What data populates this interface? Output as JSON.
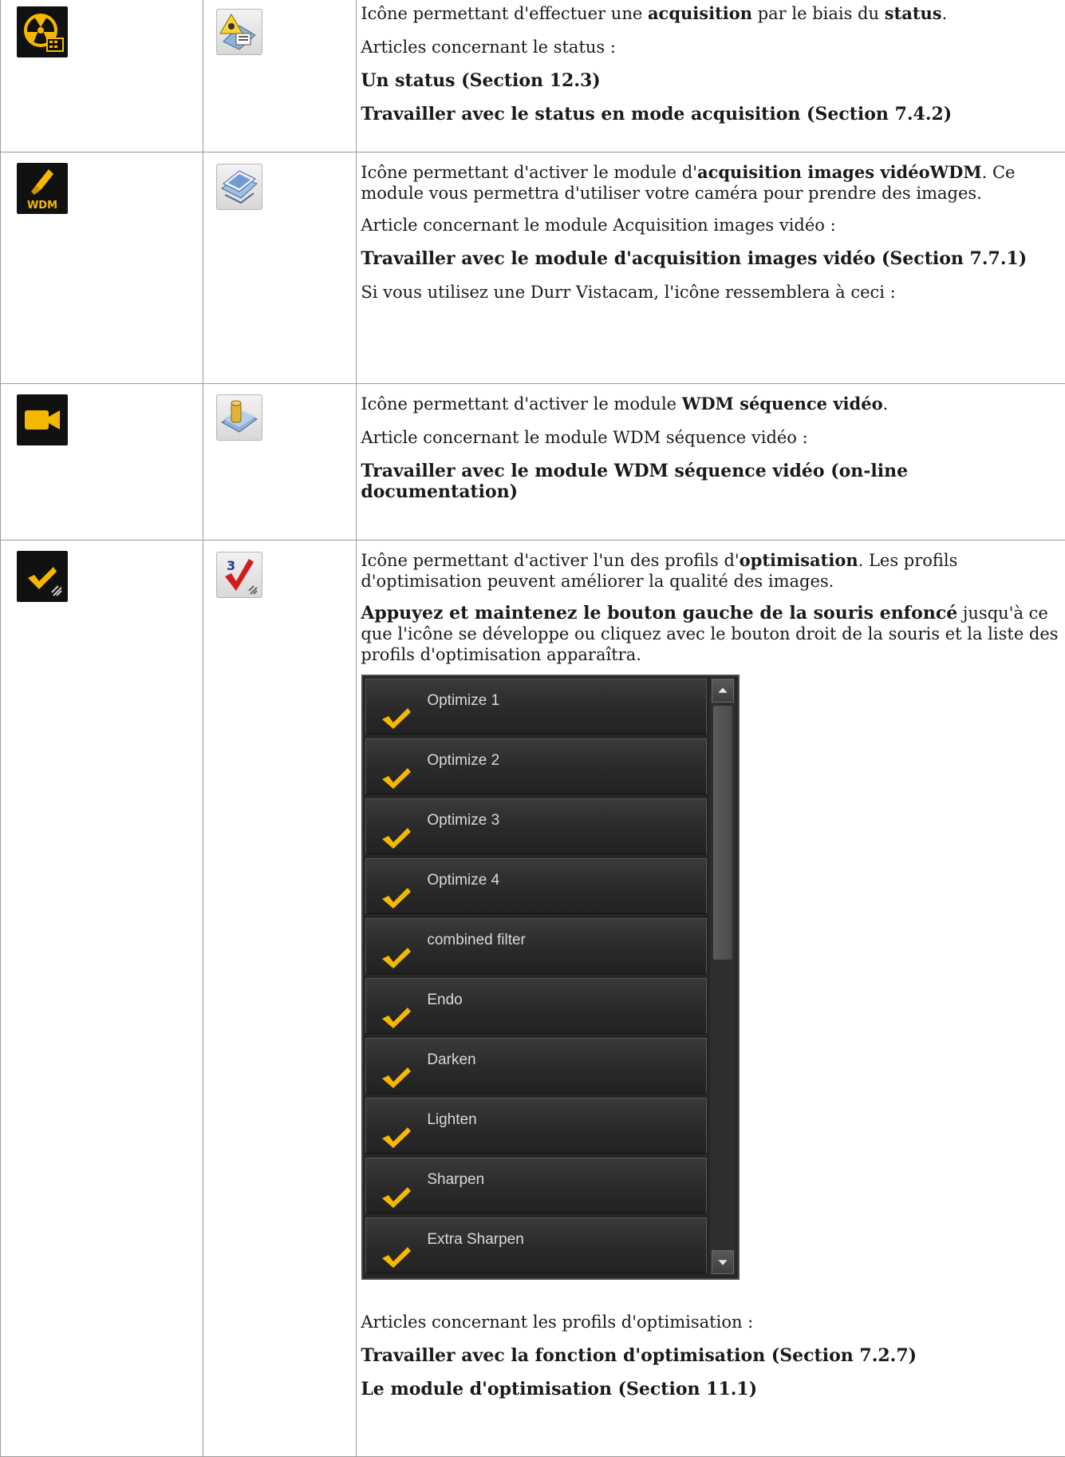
{
  "rows": [
    {
      "dark_icon": "radiation-status-icon",
      "light_icon": "status-acquisition-icon",
      "paragraphs": [
        {
          "pre": "Icône permettant d'effectuer une ",
          "b1": "acquisition",
          "mid": " par le biais du ",
          "b2": "status",
          "post": "."
        },
        {
          "text": "Articles concernant le status :"
        },
        {
          "text": "Un status (Section 12.3)"
        },
        {
          "text": "Travailler avec le status en mode acquisition (Section 7.4.2)"
        }
      ]
    },
    {
      "dark_icon": "wdm-camera-icon",
      "dark_icon_label": "WDM",
      "light_icon": "video-images-icon",
      "paragraphs": [
        {
          "pre": "Icône permettant d'activer le module d'",
          "b1": "acquisition images vidéoWDM",
          "post": ". Ce module vous permettra d'utiliser votre caméra pour prendre des images."
        },
        {
          "text": "Article concernant le module Acquisition images vidéo :"
        },
        {
          "text": "Travailler avec le module d'acquisition images vidéo (Section 7.7.1)"
        },
        {
          "text": "Si vous utilisez une Durr Vistacam, l'icône ressemblera à ceci :"
        }
      ]
    },
    {
      "dark_icon": "video-camera-icon",
      "light_icon": "video-sequence-icon",
      "paragraphs": [
        {
          "pre": "Icône permettant d'activer le module ",
          "b1": "WDM séquence vidéo",
          "post": "."
        },
        {
          "text": "Article concernant le module WDM séquence vidéo :"
        },
        {
          "text": "Travailler avec le module WDM séquence vidéo (on-line documentation)"
        }
      ]
    },
    {
      "dark_icon": "checkmark-icon",
      "light_icon": "optimize-3-checkmark-icon",
      "light_icon_label": "3",
      "paragraphs": [
        {
          "pre": "Icône permettant d'activer l'un des profils d'",
          "b1": "optimisation",
          "post": ". Les profils d'optimisation peuvent améliorer la qualité des images."
        },
        {
          "bold_lead": "Appuyez et maintenez le bouton gauche de la souris enfoncé",
          "post": " jusqu'à ce que l'icône se développe ou cliquez avec le bouton droit de la souris et la liste des profils d'optimisation apparaîtra."
        },
        {
          "text": "Articles concernant les profils d'optimisation :"
        },
        {
          "text": "Travailler avec la fonction d'optimisation (Section 7.2.7)"
        },
        {
          "text": "Le module d'optimisation (Section 11.1)"
        }
      ],
      "profiles": [
        "Optimize 1",
        "Optimize 2",
        "Optimize 3",
        "Optimize 4",
        "combined filter",
        "Endo",
        "Darken",
        "Lighten",
        "Sharpen",
        "Extra Sharpen"
      ]
    }
  ],
  "colors": {
    "accent": "#f5b800",
    "dark_bg": "#111111",
    "list_bg": "#262626",
    "border": "#9b9b9b"
  }
}
